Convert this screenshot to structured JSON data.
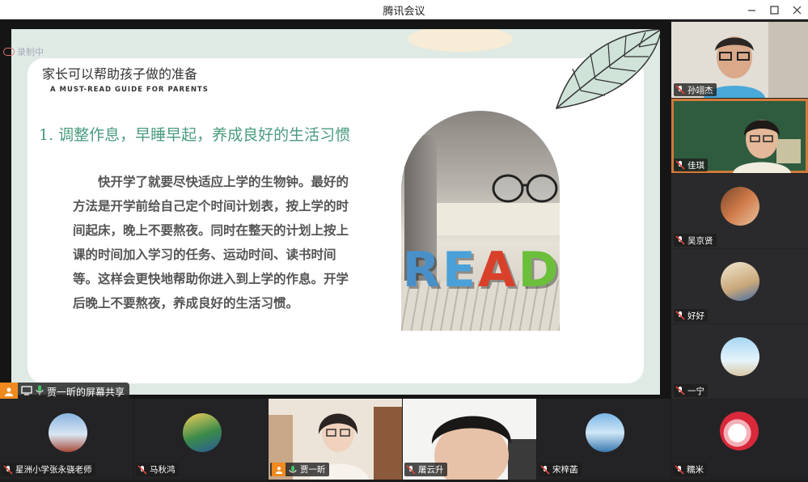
{
  "window": {
    "title": "腾讯会议",
    "minimize_icon": "minimize-icon",
    "maximize_icon": "maximize-icon",
    "close_icon": "close-icon"
  },
  "recording": {
    "label": "录制中"
  },
  "slide": {
    "title": "家长可以帮助孩子做的准备",
    "subtitle": "A MUST-READ GUIDE FOR PARENTS",
    "heading": "1. 调整作息，早睡早起，养成良好的生活习惯",
    "body": "快开学了就要尽快适应上学的生物钟。最好的方法是开学前给自己定个时间计划表，按上学的时间起床，晚上不要熬夜。同时在整天的计划上按上课的时间加入学习的任务、运动时间、读书时间等。这样会更快地帮助你进入到上学的作息。开学后晚上不要熬夜，养成良好的生活习惯。",
    "image_letters": [
      "R",
      "E",
      "A",
      "D"
    ],
    "letter_colors": [
      "#4a90c8",
      "#4aa0d8",
      "#d9402a",
      "#6bbf3a"
    ]
  },
  "share_tag": {
    "label": "贾一昕的屏幕共享"
  },
  "right_participants": [
    {
      "name": "孙翊杰"
    },
    {
      "name": "佳琪"
    },
    {
      "name": "吴京贤"
    },
    {
      "name": "好好"
    },
    {
      "name": "一宁"
    },
    {
      "name": "糯米"
    }
  ],
  "bottom_participants": [
    {
      "name": "星洲小学张永骁老师"
    },
    {
      "name": "马秋鸿"
    },
    {
      "name": "贾一昕"
    },
    {
      "name": "屠云升"
    },
    {
      "name": "宋梓菡"
    }
  ],
  "colors": {
    "accent_green": "#4a9b7d",
    "share_orange": "#f08a1e",
    "mic_red": "#e0463a"
  }
}
